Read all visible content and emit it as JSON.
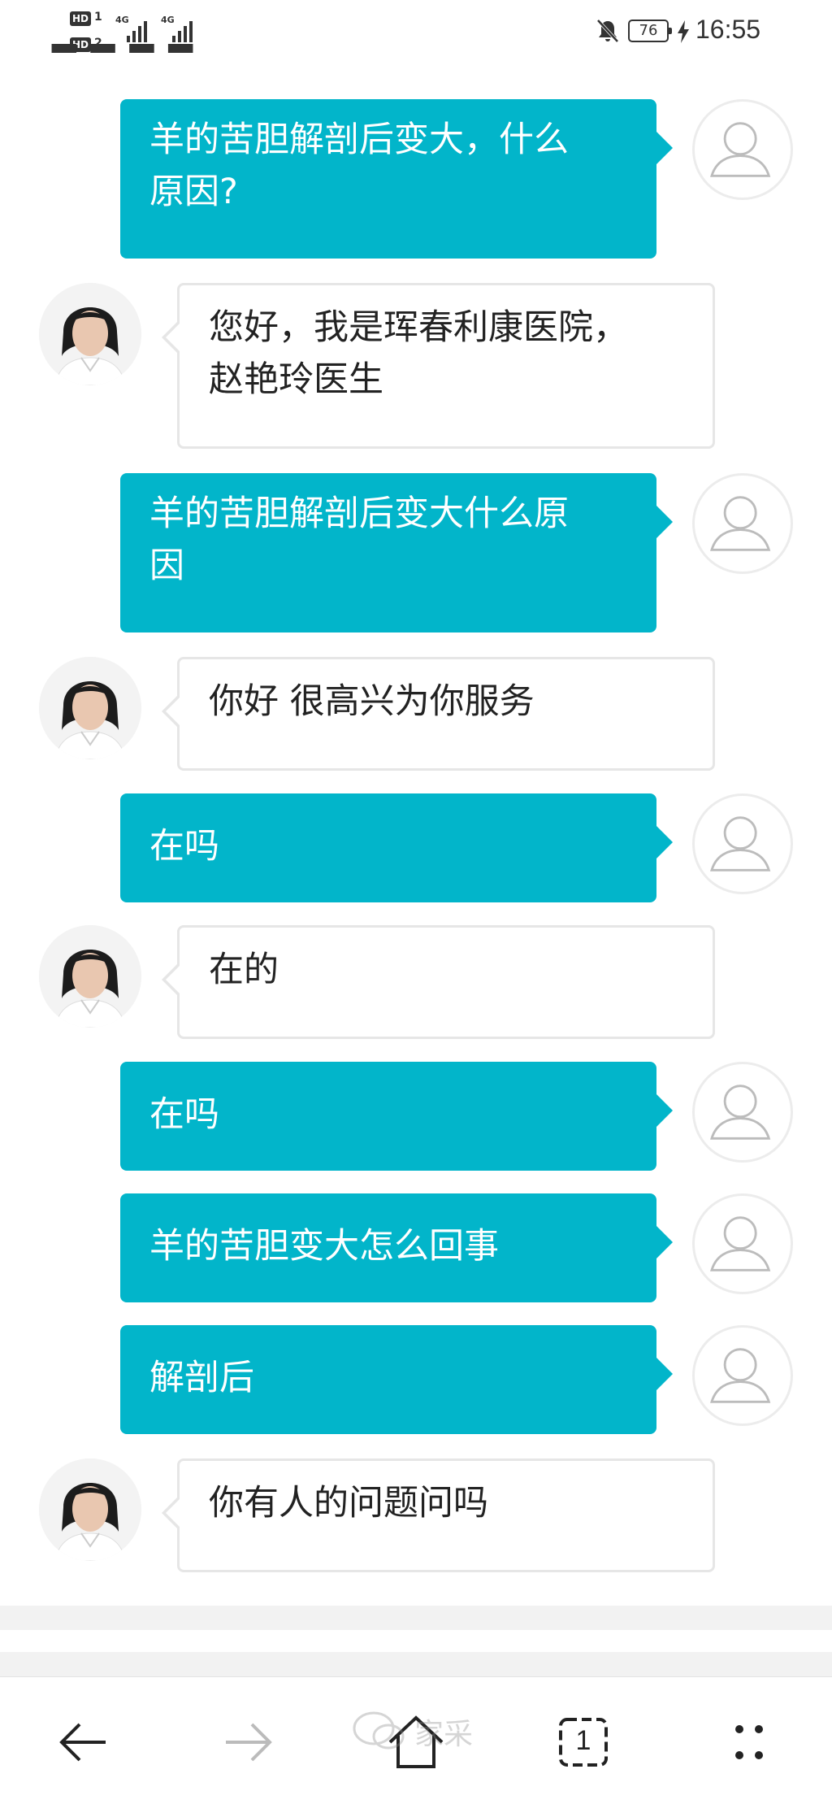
{
  "status_bar": {
    "sim1": "HD",
    "sim1_num": "1",
    "sim2": "HD",
    "sim2_num": "2",
    "network1": "4G",
    "network2": "4G",
    "battery": "76",
    "time": "16:55"
  },
  "chat": {
    "user_avatar_icon": "person-outline-icon",
    "messages": [
      {
        "from": "user",
        "text_lines": [
          "羊的苦胆解剖后变大，什么",
          "原因?"
        ]
      },
      {
        "from": "doctor",
        "text_lines": [
          "您好，我是珲春利康医院，",
          "赵艳玲医生"
        ]
      },
      {
        "from": "user",
        "text_lines": [
          "羊的苦胆解剖后变大什么原",
          "因"
        ]
      },
      {
        "from": "doctor",
        "text_lines": [
          "你好 很高兴为你服务"
        ]
      },
      {
        "from": "user",
        "text_lines": [
          "在吗"
        ]
      },
      {
        "from": "doctor",
        "text_lines": [
          "在的"
        ]
      },
      {
        "from": "user",
        "text_lines": [
          "在吗"
        ]
      },
      {
        "from": "user",
        "text_lines": [
          "羊的苦胆变大怎么回事"
        ]
      },
      {
        "from": "user",
        "text_lines": [
          "解剖后"
        ]
      },
      {
        "from": "doctor",
        "text_lines": [
          "你有人的问题问吗"
        ]
      }
    ]
  },
  "nav_bar": {
    "back_icon": "arrow-left-icon",
    "forward_icon": "arrow-right-icon",
    "home_icon": "home-icon",
    "tabs_count": "1",
    "menu_icon": "four-dots-menu-icon"
  },
  "watermark": "家采"
}
